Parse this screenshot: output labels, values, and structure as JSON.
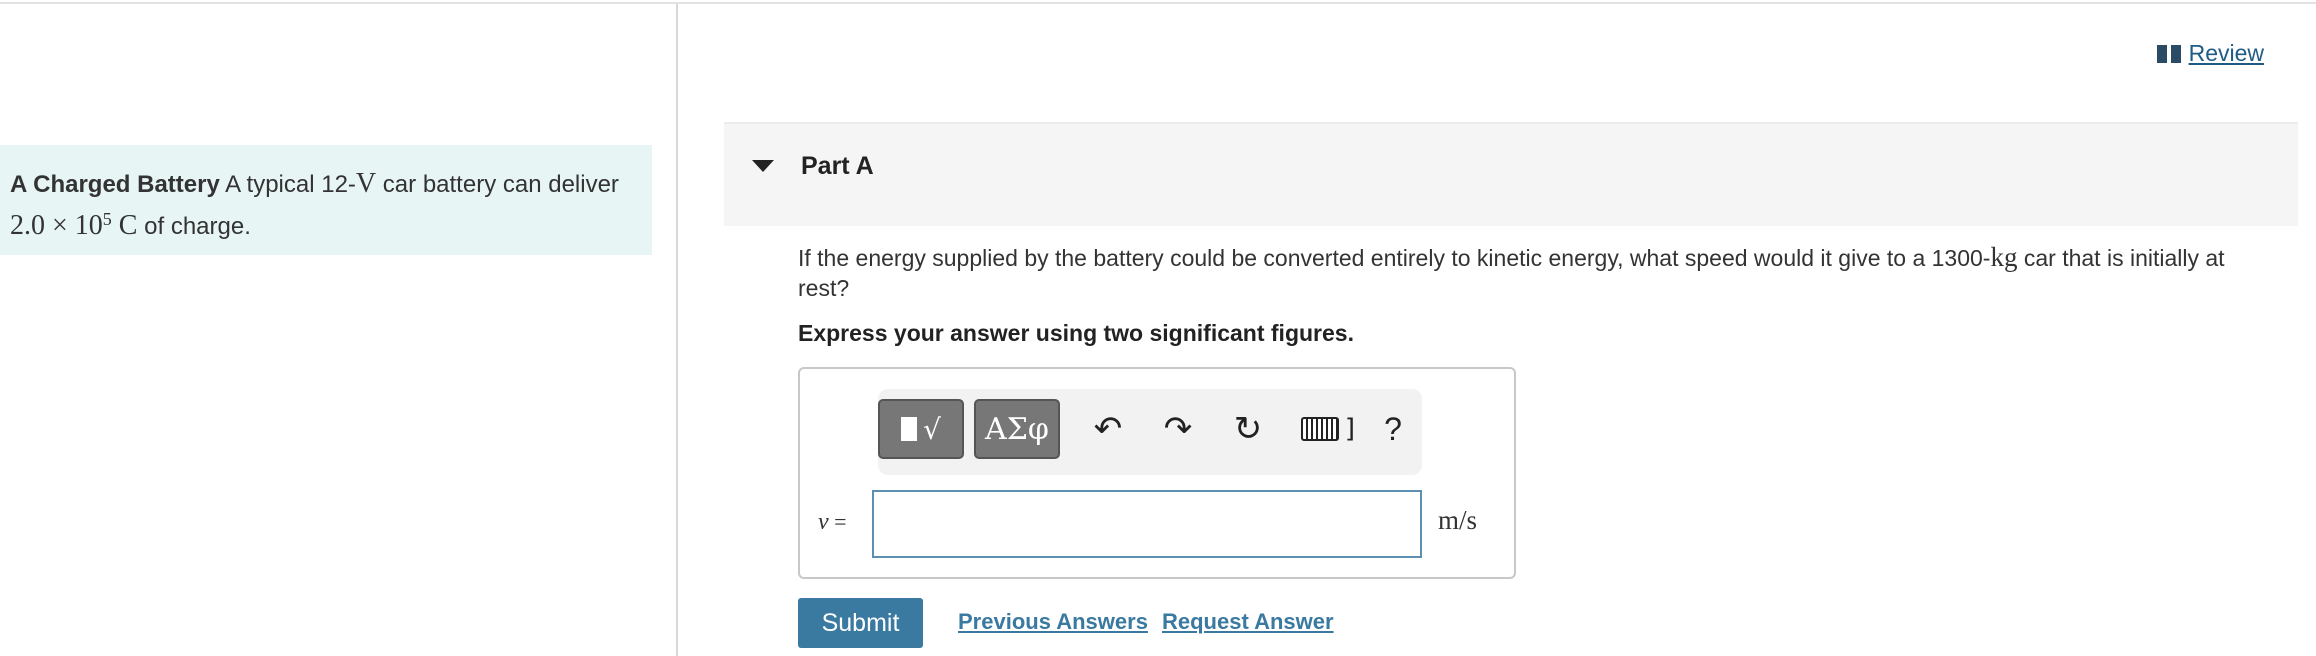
{
  "review": {
    "label": "Review",
    "icon": "book-icon"
  },
  "intro": {
    "bold_title": "A Charged Battery",
    "text_1": " A typical 12-",
    "volt_symbol": "V",
    "text_2": " car battery can deliver",
    "charge_mantissa": "2.0 × 10",
    "charge_exponent": "5",
    "charge_unit": " C",
    "text_3": " of charge."
  },
  "part": {
    "title": "Part A"
  },
  "question": {
    "text_1": "If the energy supplied by the battery could be converted entirely to kinetic energy, what speed would it give to a 1300-",
    "mass_unit": "kg",
    "text_2": " car that is initially at rest?"
  },
  "instruction": "Express your answer using two significant figures.",
  "toolbar": {
    "templates_label": "√",
    "greek_label": "ΑΣφ",
    "undo_icon": "↶",
    "redo_icon": "↷",
    "reset_icon": "↻",
    "keyboard_suffix": "]",
    "help_label": "?"
  },
  "answer": {
    "variable": "v",
    "equals": " =",
    "value": "",
    "unit": "m/s"
  },
  "actions": {
    "submit_label": "Submit",
    "previous_answers_label": "Previous Answers",
    "request_answer_label": "Request Answer"
  }
}
